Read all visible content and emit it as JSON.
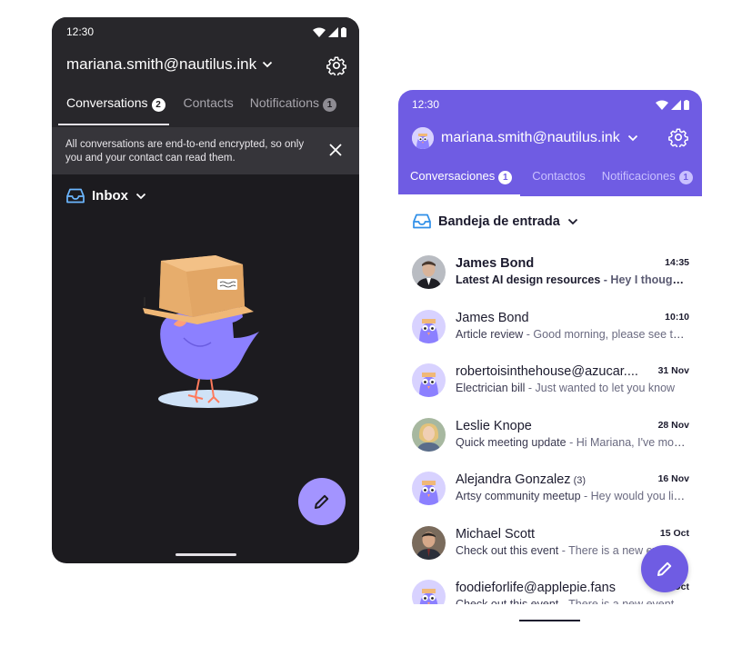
{
  "dark_phone": {
    "status_time": "12:30",
    "account_email": "mariana.smith@nautilus.ink",
    "tabs": [
      {
        "label": "Conversations",
        "badge": "2"
      },
      {
        "label": "Contacts",
        "badge": ""
      },
      {
        "label": "Notifications",
        "badge": "1"
      }
    ],
    "banner_text": "All conversations are end-to-end encrypted, so only you and your contact can read them.",
    "folder_label": "Inbox"
  },
  "light_phone": {
    "status_time": "12:30",
    "account_email": "mariana.smith@nautilus.ink",
    "tabs": [
      {
        "label": "Conversaciones",
        "badge": "1"
      },
      {
        "label": "Contactos",
        "badge": ""
      },
      {
        "label": "Notificaciones",
        "badge": "1"
      }
    ],
    "folder_label": "Bandeja de entrada",
    "conversations": [
      {
        "name": "James Bond",
        "count": "",
        "time": "14:35",
        "subject": "Latest AI design resources",
        "preview": " - Hey I thought you might find these resources useful",
        "unread": true,
        "avatar": "photo-man"
      },
      {
        "name": "James Bond",
        "count": "",
        "time": "10:10",
        "subject": "Article review",
        "preview": " - Good morning, please see the attached article",
        "unread": false,
        "avatar": "bird"
      },
      {
        "name": "robertoisinthehouse@azucar....",
        "count": "",
        "time": "31 Nov",
        "subject": "Electrician bill",
        "preview": " - Just wanted to let you know",
        "unread": false,
        "avatar": "bird"
      },
      {
        "name": "Leslie Knope",
        "count": "",
        "time": "28 Nov",
        "subject": "Quick meeting update",
        "preview": " - Hi Mariana, I've moved the meeting",
        "unread": false,
        "avatar": "photo-woman"
      },
      {
        "name": "Alejandra Gonzalez",
        "count": "(3)",
        "time": "16 Nov",
        "subject": "Artsy community meetup",
        "preview": " - Hey would you like to join",
        "unread": false,
        "avatar": "bird"
      },
      {
        "name": "Michael Scott",
        "count": "",
        "time": "15 Oct",
        "subject": "Check out this event",
        "preview": " - There is a new event",
        "unread": false,
        "avatar": "photo-man2"
      },
      {
        "name": "foodieforlife@applepie.fans",
        "count": "",
        "time": "11 Oct",
        "subject": "Check out this event",
        "preview": " - There is a new event",
        "unread": false,
        "avatar": "bird"
      }
    ]
  },
  "colors": {
    "dark_bg": "#1c1b1f",
    "dark_header": "#28272b",
    "accent_light": "#6f5ce3",
    "fab_dark": "#a394ff"
  },
  "icons": [
    "wifi-icon",
    "signal-icon",
    "battery-icon",
    "chevron-down-icon",
    "gear-icon",
    "close-icon",
    "inbox-icon",
    "pencil-icon"
  ]
}
